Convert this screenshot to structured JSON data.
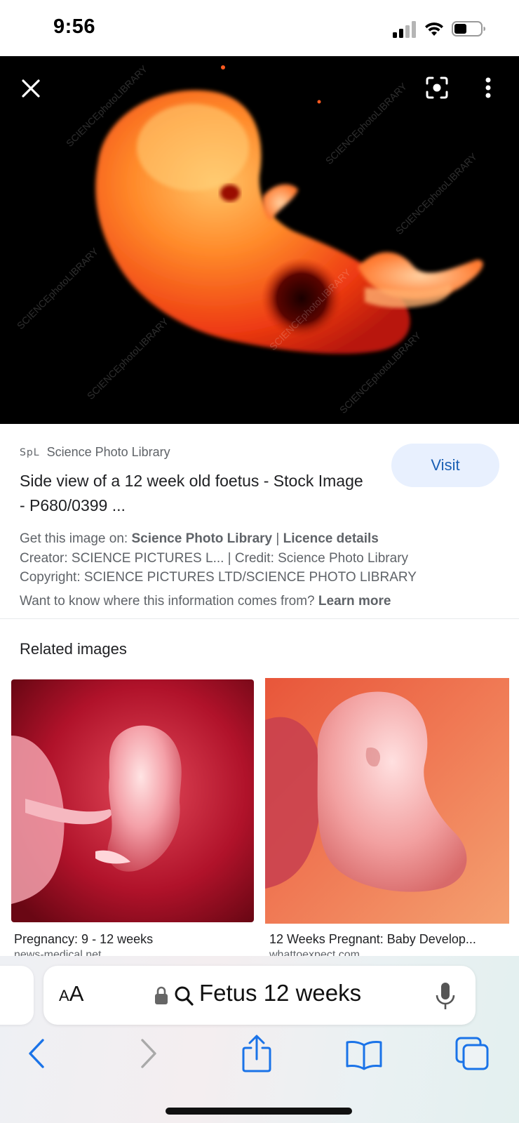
{
  "status_bar": {
    "time": "9:56"
  },
  "viewer": {
    "close_icon": "close-icon",
    "lens_icon": "google-lens-icon",
    "more_icon": "more-vert-icon",
    "watermark": "SCIENCEphotoLIBRARY"
  },
  "result": {
    "source_logo": "SpL",
    "source_name": "Science Photo Library",
    "visit_label": "Visit",
    "title": "Side view of a 12 week old foetus - Stock Image - P680/0399 ...",
    "get_image_prefix": "Get this image on:",
    "get_image_source": "Science Photo Library",
    "separator": "|",
    "licence_details": "Licence details",
    "creator": "Creator: SCIENCE PICTURES L... | Credit: Science Photo Library",
    "copyright": "Copyright: SCIENCE PICTURES LTD/SCIENCE PHOTO LIBRARY",
    "info_question": "Want to know where this information comes from?",
    "learn_more": "Learn more"
  },
  "related": {
    "heading": "Related images",
    "items": [
      {
        "caption": "Pregnancy: 9 - 12 weeks",
        "source": "news-medical.net"
      },
      {
        "caption": "12 Weeks Pregnant: Baby Develop...",
        "source": "whattoexpect.com"
      }
    ]
  },
  "browser": {
    "text_size_label_small": "A",
    "text_size_label_large": "A",
    "url_text": "Fetus 12 weeks",
    "accent_color": "#1a73e8"
  }
}
